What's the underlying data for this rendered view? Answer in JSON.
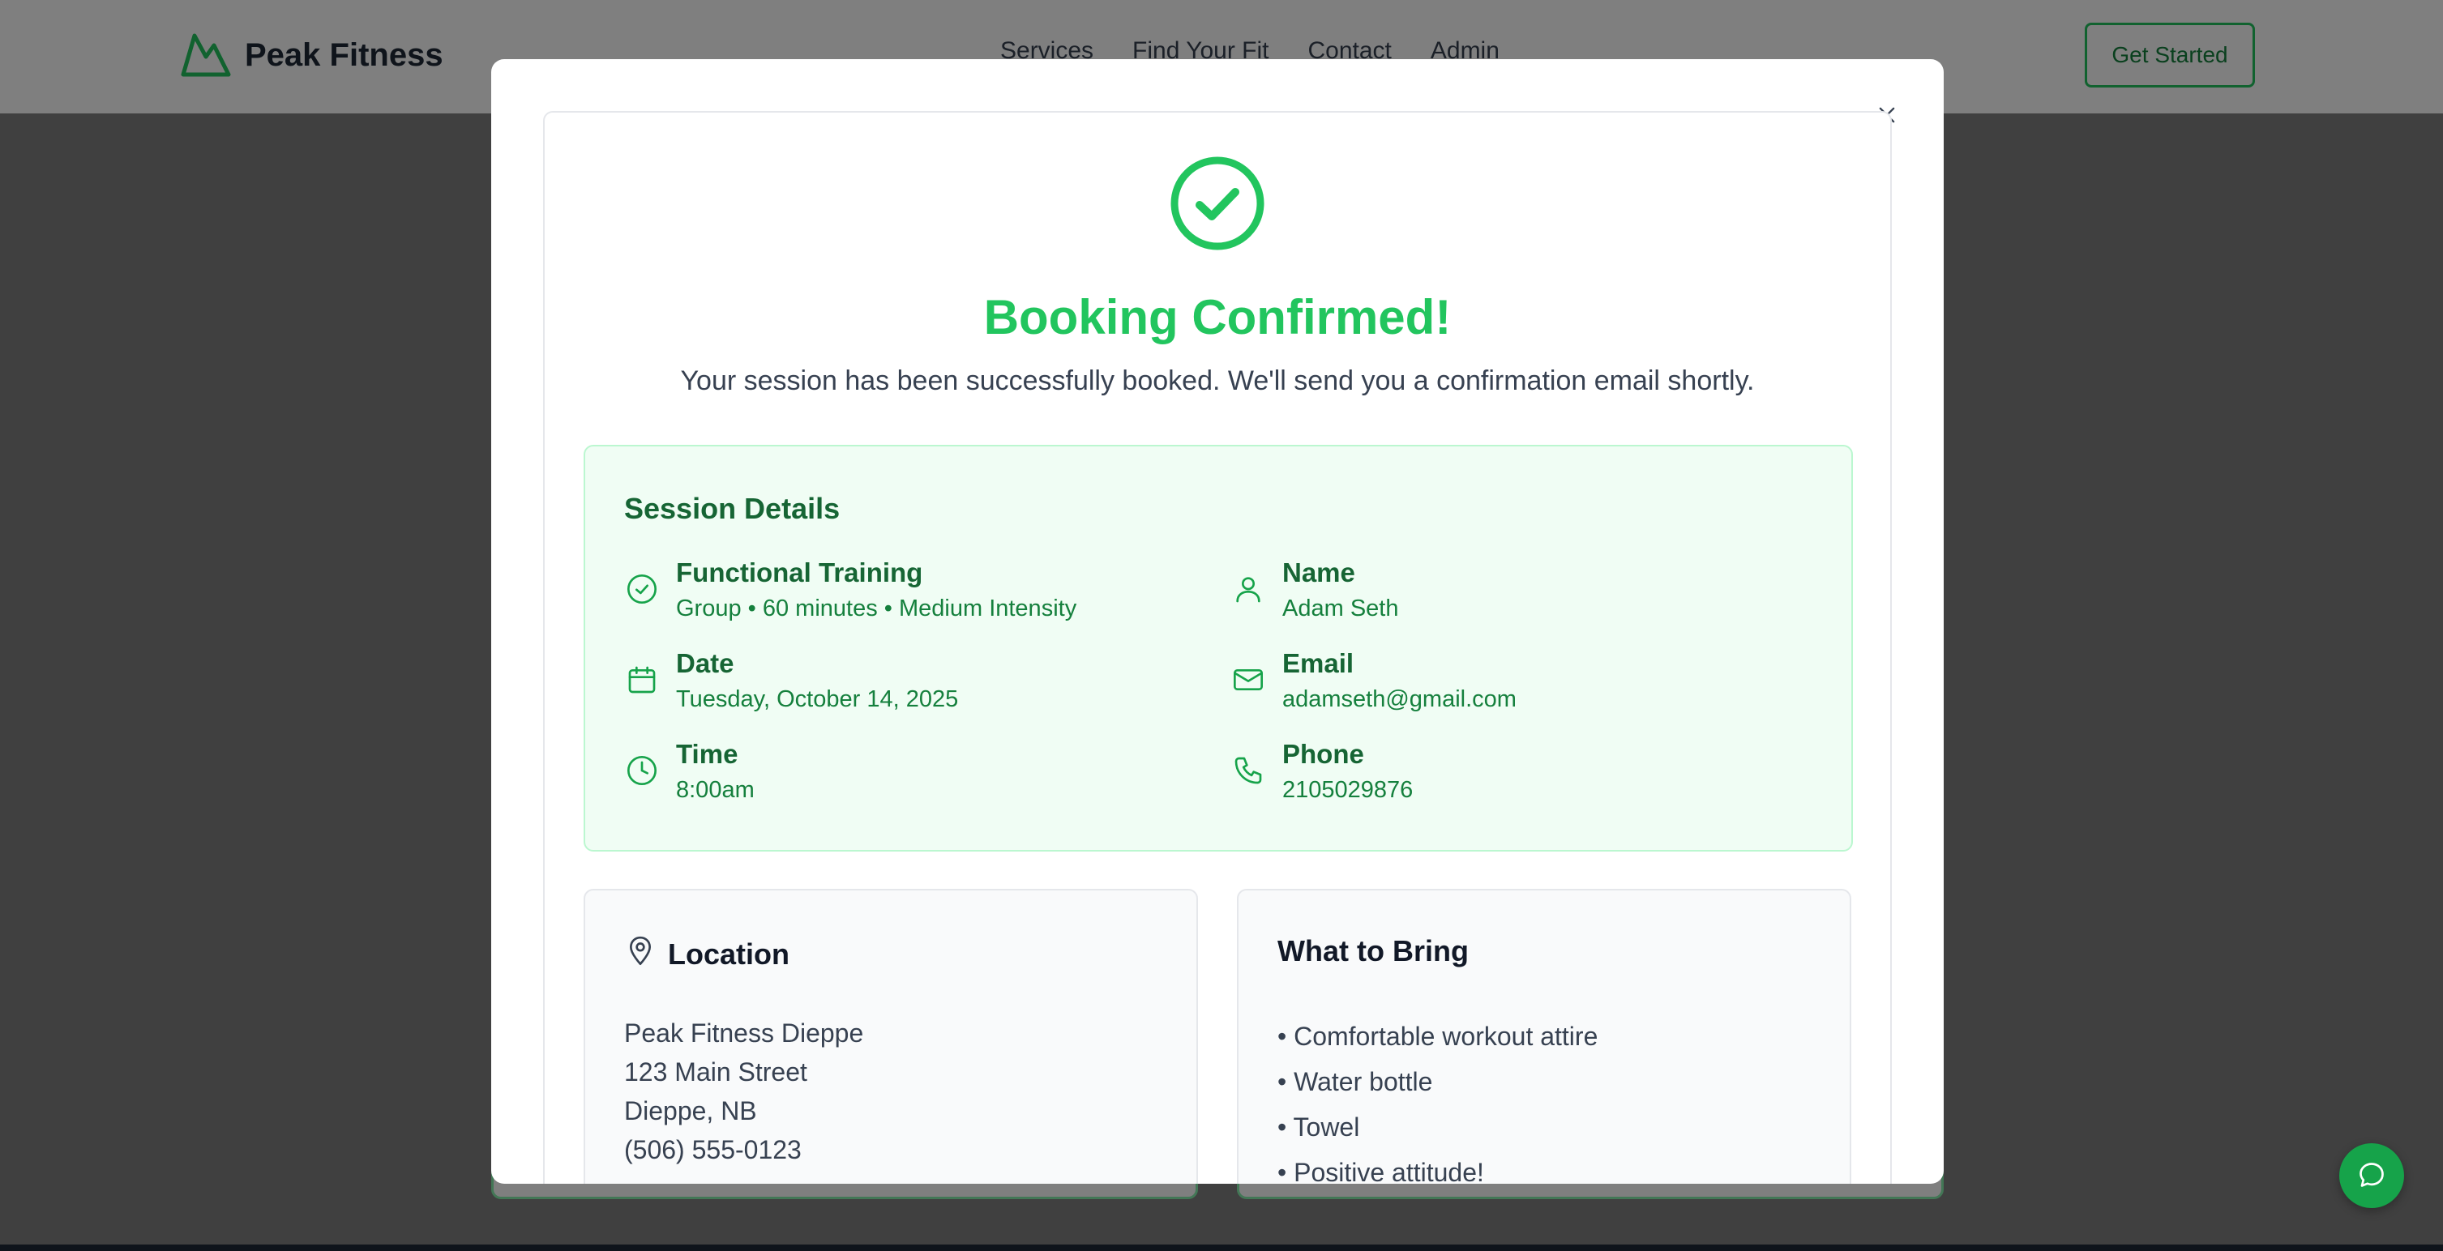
{
  "header": {
    "brand": "Peak Fitness",
    "nav": [
      "Services",
      "Find Your Fit",
      "Contact",
      "Admin"
    ],
    "cta_label": "Get Started"
  },
  "modal": {
    "title": "Booking Confirmed!",
    "subtitle": "Your session has been successfully booked. We'll send you a confirmation email shortly.",
    "session": {
      "heading": "Session Details",
      "service_label": "Functional Training",
      "service_value": "Group • 60 minutes • Medium Intensity",
      "date_label": "Date",
      "date_value": "Tuesday, October 14, 2025",
      "time_label": "Time",
      "time_value": "8:00am",
      "name_label": "Name",
      "name_value": "Adam Seth",
      "email_label": "Email",
      "email_value": "adamseth@gmail.com",
      "phone_label": "Phone",
      "phone_value": "2105029876"
    },
    "location": {
      "heading": "Location",
      "lines": [
        "Peak Fitness Dieppe",
        "123 Main Street",
        "Dieppe, NB",
        "(506) 555-0123"
      ]
    },
    "bring": {
      "heading": "What to Bring",
      "items": [
        "• Comfortable workout attire",
        "• Water bottle",
        "• Towel",
        "• Positive attitude!"
      ]
    }
  },
  "icons": {
    "brand": "mountain-icon",
    "close": "close-icon",
    "success": "check-circle-icon",
    "service": "check-circle-small-icon",
    "date": "calendar-icon",
    "time": "clock-icon",
    "name": "user-icon",
    "email": "mail-icon",
    "phone": "phone-icon",
    "location": "map-pin-icon",
    "chat": "chat-bubble-icon"
  },
  "colors": {
    "accent": "#22c55e",
    "accent_dark": "#166534",
    "session_bg": "#f0fdf4"
  }
}
